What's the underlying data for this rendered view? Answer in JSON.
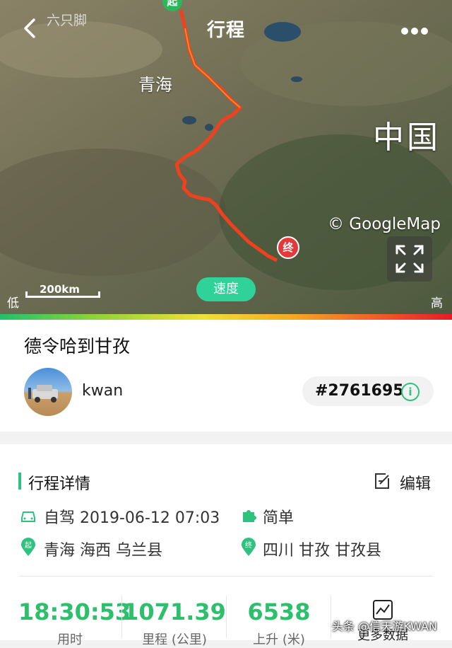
{
  "topbar": {
    "app_name": "六只脚",
    "title": "行程"
  },
  "map": {
    "province_label": "青海",
    "country_label": "中国",
    "copyright": "© GoogleMap",
    "scale": "200km",
    "start_pin": "起",
    "end_pin": "终",
    "speed_button": "速度",
    "legend_low": "低",
    "legend_high": "高"
  },
  "trip": {
    "title": "德令哈到甘孜",
    "username": "kwan",
    "id": "#2761695"
  },
  "details": {
    "section_title": "行程详情",
    "edit_label": "编辑",
    "mode_date": "自驾 2019-06-12 07:03",
    "difficulty": "简单",
    "start_location": "青海 海西 乌兰县",
    "end_location": "四川 甘孜 甘孜县"
  },
  "stats": [
    {
      "value": "18:30:53",
      "label": "用时"
    },
    {
      "value": "1071.39",
      "label": "里程 (公里)"
    },
    {
      "value": "6538",
      "label": "上升 (米)"
    }
  ],
  "more_data_label": "更多数据",
  "watermark": "头条 @信天游KWAN",
  "colors": {
    "accent": "#2fc27e",
    "stat_value": "#2dbf6c",
    "start_pin": "#2bb85a",
    "end_pin": "#e5383b",
    "track": "#f0401e"
  }
}
